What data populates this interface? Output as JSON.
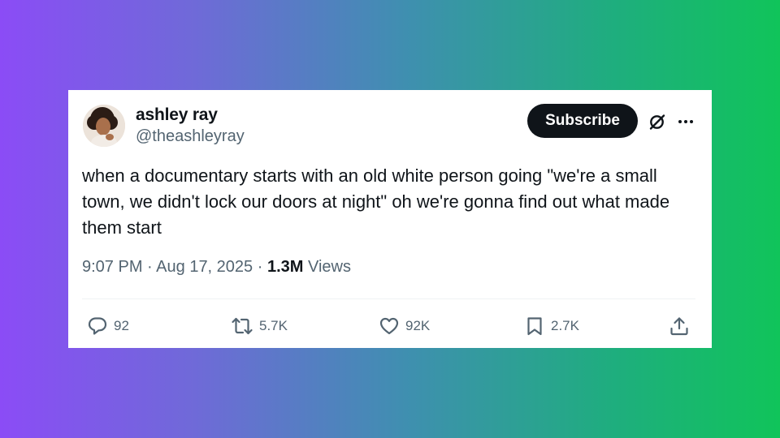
{
  "author": {
    "display_name": "ashley ray",
    "handle": "@theashleyray"
  },
  "header": {
    "subscribe_label": "Subscribe",
    "icons": [
      "grok-icon",
      "more-icon"
    ]
  },
  "tweet": {
    "text": "when a documentary starts with an old white person going \"we're a small town, we didn't lock our doors at night\" oh we're gonna find out what made them start",
    "time": "9:07 PM",
    "date": "Aug 17, 2025",
    "separator": "·",
    "views_count": "1.3M",
    "views_label": "Views"
  },
  "actions": {
    "replies": "92",
    "reposts": "5.7K",
    "likes": "92K",
    "bookmarks": "2.7K",
    "icons": [
      "reply-icon",
      "repost-icon",
      "like-icon",
      "bookmark-icon",
      "share-icon"
    ]
  },
  "colors": {
    "background_start": "#8b4cf6",
    "background_end": "#10c45a",
    "text_primary": "#0f1419",
    "text_secondary": "#536471",
    "button_bg": "#0f1419"
  }
}
